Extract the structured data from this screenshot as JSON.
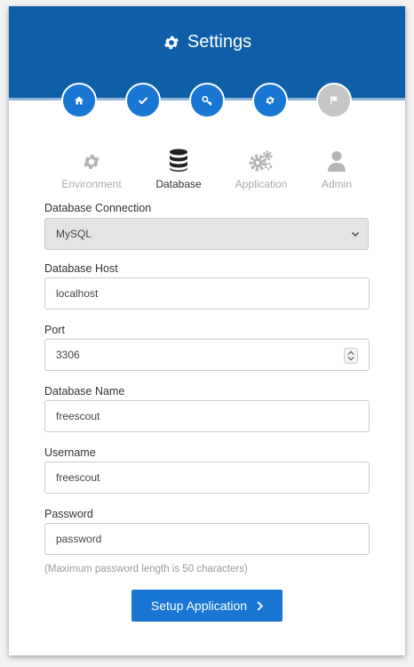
{
  "header": {
    "title": "Settings",
    "title_icon": "gear-icon",
    "color": "#0e5fa8"
  },
  "steps": [
    {
      "icon": "home-icon",
      "state": "done"
    },
    {
      "icon": "check-icon",
      "state": "done"
    },
    {
      "icon": "key-icon",
      "state": "done"
    },
    {
      "icon": "gear-icon",
      "state": "current"
    },
    {
      "icon": "flag-icon",
      "state": "pending"
    }
  ],
  "tabs": [
    {
      "label": "Environment",
      "icon": "gear-icon",
      "active": false
    },
    {
      "label": "Database",
      "icon": "database-icon",
      "active": true
    },
    {
      "label": "Application",
      "icon": "gears-icon",
      "active": false
    },
    {
      "label": "Admin",
      "icon": "user-icon",
      "active": false
    }
  ],
  "form": {
    "connection": {
      "label": "Database Connection",
      "value": "MySQL"
    },
    "host": {
      "label": "Database Host",
      "value": "localhost"
    },
    "port": {
      "label": "Port",
      "value": "3306"
    },
    "name": {
      "label": "Database Name",
      "value": "freescout"
    },
    "username": {
      "label": "Username",
      "value": "freescout"
    },
    "password": {
      "label": "Password",
      "value": "password"
    },
    "hint": "(Maximum password length is 50 characters)"
  },
  "submit": {
    "label": "Setup Application",
    "color": "#1976d2"
  }
}
